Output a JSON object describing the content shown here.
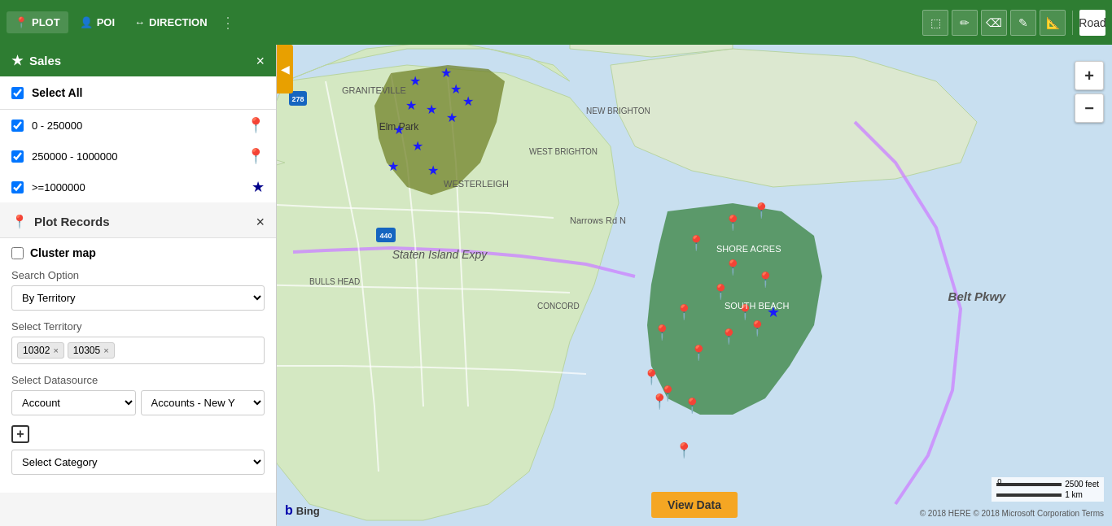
{
  "toolbar": {
    "plot_label": "PLOT",
    "poi_label": "POI",
    "direction_label": "DIRECTION",
    "more_icon": "⋮"
  },
  "map_tools": {
    "select_icon": "⬚",
    "pencil_icon": "✏",
    "eraser_icon": "⌫",
    "edit_icon": "✎",
    "measure_icon": "📐",
    "road_label": "Road"
  },
  "sales_panel": {
    "title": "Sales",
    "close_label": "×",
    "select_all_label": "Select All",
    "legend": [
      {
        "range": "0 - 250000",
        "color": "brown"
      },
      {
        "range": "250000 - 1000000",
        "color": "purple"
      },
      {
        "range": ">=1000000",
        "color": "blue"
      }
    ]
  },
  "plot_panel": {
    "title": "Plot Records",
    "close_label": "×",
    "cluster_map_label": "Cluster map",
    "search_option_label": "Search Option",
    "search_option_value": "By Territory",
    "search_option_placeholder": "By Territory",
    "select_territory_label": "Select Territory",
    "territory_tags": [
      "10302",
      "10305"
    ],
    "select_datasource_label": "Select Datasource",
    "datasource_options": [
      "Account",
      "Accounts - New Y"
    ],
    "add_category_label": "+",
    "select_category_label": "Select Category"
  },
  "view_data_btn": "View Data",
  "zoom": {
    "in": "+",
    "out": "−"
  },
  "scale": {
    "feet": "2500 feet",
    "km": "1 km"
  },
  "copyright": "© 2018 HERE © 2018 Microsoft Corporation Terms",
  "bing": "Bing"
}
